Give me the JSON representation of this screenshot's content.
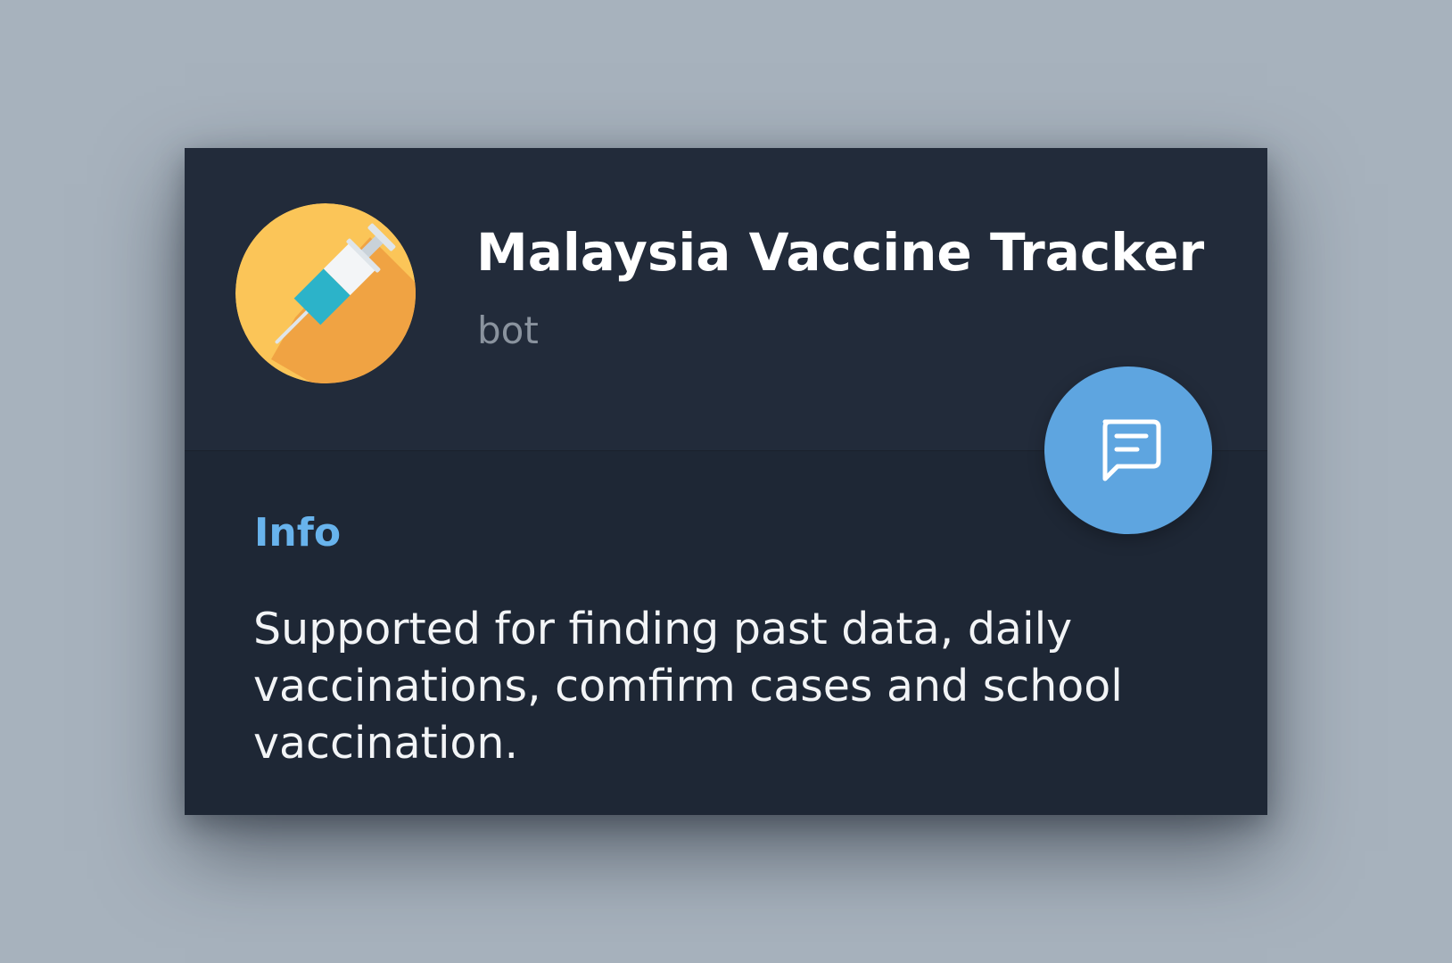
{
  "profile": {
    "name": "Malaysia Vaccine Tracker",
    "type": "bot",
    "avatar_icon": "syringe-icon",
    "avatar_color": "#fbc558"
  },
  "actions": {
    "message_button_icon": "chat-bubble-icon",
    "message_button_color": "#5ea5e0"
  },
  "info": {
    "label": "Info",
    "bio": "Supported for finding past data, daily vaccinations, comfirm cases and school vaccination."
  },
  "colors": {
    "card_background": "#1e2735",
    "header_background": "#222b3a",
    "accent": "#68b3ec"
  }
}
